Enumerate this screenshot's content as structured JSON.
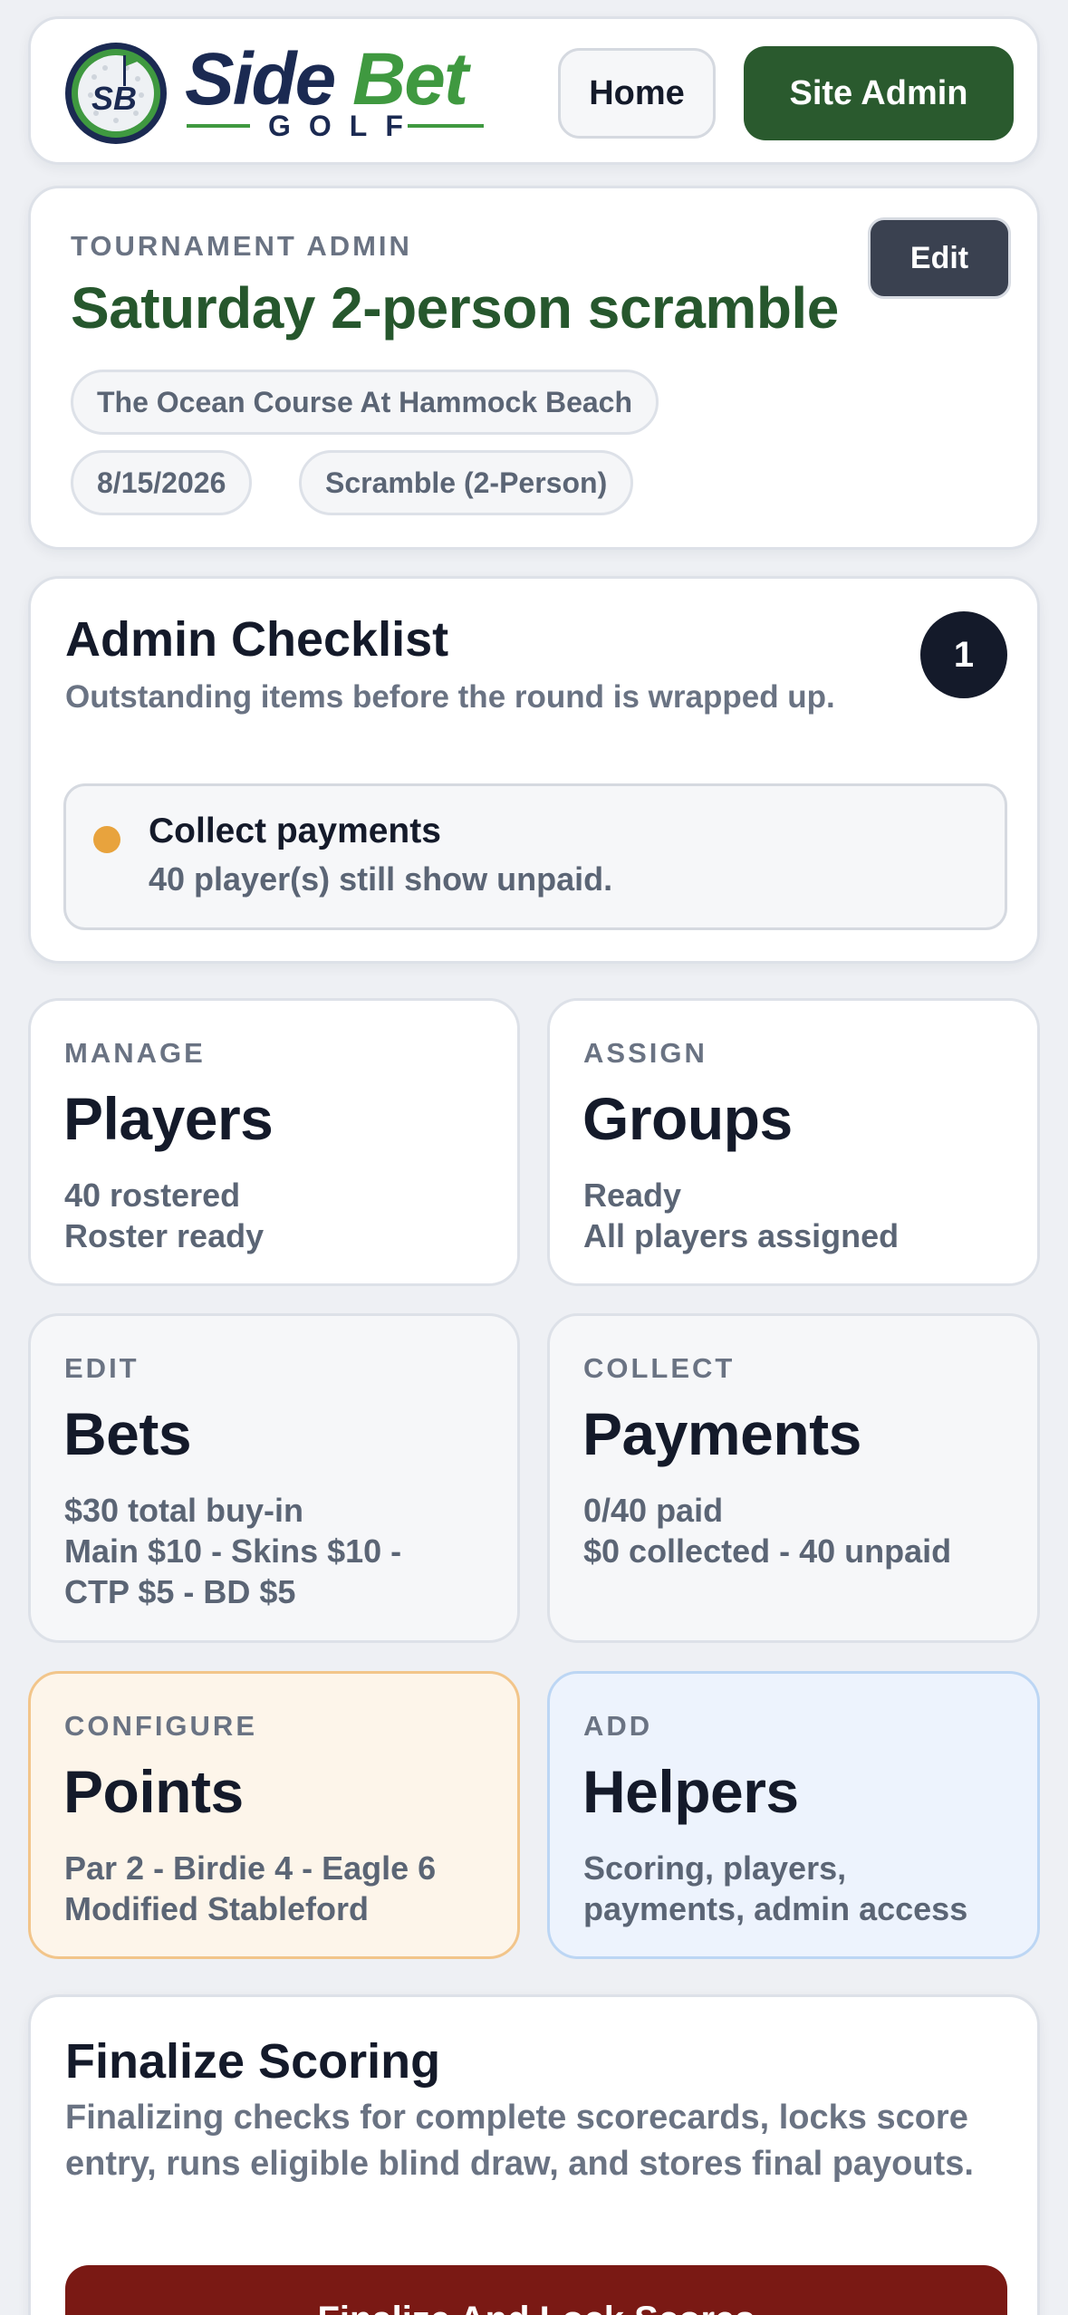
{
  "header": {
    "logo": {
      "word_side": "Side",
      "word_bet": "Bet",
      "word_golf": "GOLF",
      "badge_text": "SB"
    },
    "home_label": "Home",
    "site_admin_label": "Site Admin"
  },
  "tournament": {
    "eyebrow": "TOURNAMENT ADMIN",
    "title": "Saturday 2-person scramble",
    "edit_label": "Edit",
    "course": "The Ocean Course At Hammock Beach",
    "date": "8/15/2026",
    "format": "Scramble (2-Person)"
  },
  "checklist": {
    "title": "Admin Checklist",
    "subtitle": "Outstanding items before the round is wrapped up.",
    "count": "1",
    "items": [
      {
        "title": "Collect payments",
        "detail": "40 player(s) still show unpaid.",
        "status_color": "#e8a33d"
      }
    ]
  },
  "tiles": {
    "players": {
      "eyebrow": "MANAGE",
      "title": "Players",
      "lines": [
        "40 rostered",
        "Roster ready"
      ]
    },
    "groups": {
      "eyebrow": "ASSIGN",
      "title": "Groups",
      "lines": [
        "Ready",
        "All players assigned"
      ]
    },
    "bets": {
      "eyebrow": "EDIT",
      "title": "Bets",
      "lines": [
        "$30 total buy-in",
        "Main $10 - Skins $10 -",
        "CTP $5 - BD $5"
      ]
    },
    "payments": {
      "eyebrow": "COLLECT",
      "title": "Payments",
      "lines": [
        "0/40 paid",
        "$0 collected - 40 unpaid"
      ]
    },
    "points": {
      "eyebrow": "CONFIGURE",
      "title": "Points",
      "lines": [
        "Par 2 - Birdie 4 - Eagle 6",
        "Modified Stableford"
      ]
    },
    "helpers": {
      "eyebrow": "ADD",
      "title": "Helpers",
      "lines": [
        "Scoring, players,",
        "payments, admin access"
      ]
    }
  },
  "finalize": {
    "title": "Finalize Scoring",
    "description": "Finalizing checks for complete scorecards, locks score entry, runs eligible blind draw, and stores final payouts.",
    "button_label": "Finalize And Lock Scores"
  },
  "colors": {
    "brand_navy": "#1b2a52",
    "brand_green": "#3f9940",
    "site_admin_bg": "#2a5a2e",
    "title_green": "#26572d",
    "finalize_red": "#7a1914",
    "pending_orange": "#e8a33d"
  }
}
